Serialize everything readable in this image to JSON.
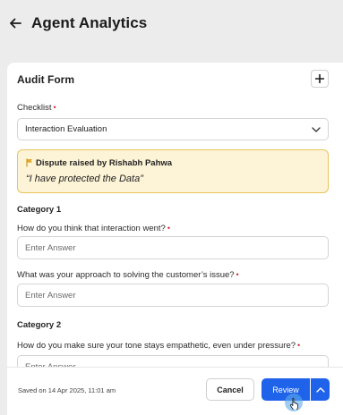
{
  "header": {
    "back_icon": "arrow-left-icon",
    "title": "Agent Analytics"
  },
  "form": {
    "title": "Audit Form",
    "add_icon": "plus-icon",
    "checklist": {
      "label": "Checklist",
      "required_mark": "•",
      "value": "Interaction Evaluation",
      "icon": "chevron-down-icon"
    },
    "dispute": {
      "icon": "flag-icon",
      "title": "Dispute raised by Rishabh Pahwa",
      "quote": "“I have protected the Data”",
      "background": "#fdf3d6",
      "border": "#e8c45c"
    },
    "categories": [
      {
        "heading": "Category 1",
        "questions": [
          {
            "label": "How do you think that interaction went?",
            "required_mark": "•",
            "placeholder": "Enter Answer",
            "value": ""
          },
          {
            "label": "What was your approach to solving the customer’s issue?",
            "required_mark": "•",
            "placeholder": "Enter Answer",
            "value": ""
          }
        ]
      },
      {
        "heading": "Category 2",
        "questions": [
          {
            "label": "How do you make sure your tone stays empathetic, even under pressure?",
            "required_mark": "•",
            "placeholder": "Enter Answer",
            "value": ""
          }
        ]
      }
    ]
  },
  "footer": {
    "saved_text": "Saved on 14 Apr 2025, 11:01 am",
    "cancel_label": "Cancel",
    "review_label": "Review",
    "review_menu_icon": "chevron-up-icon"
  },
  "colors": {
    "primary": "#1e63e9",
    "required": "#d0323b"
  }
}
